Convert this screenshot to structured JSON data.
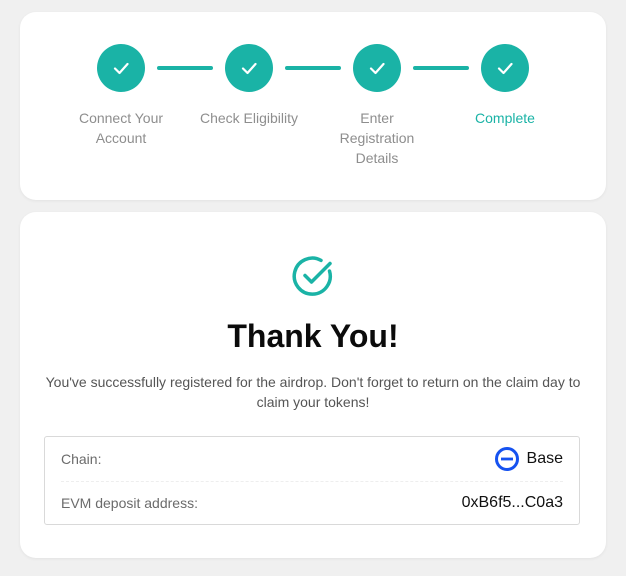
{
  "colors": {
    "accent": "#1ab3a6",
    "base_blue": "#1652f0"
  },
  "stepper": {
    "steps": [
      {
        "label": "Connect Your Account",
        "status": "done",
        "icon": "check-icon"
      },
      {
        "label": "Check Eligibility",
        "status": "done",
        "icon": "check-icon"
      },
      {
        "label": "Enter Registration Details",
        "status": "done",
        "icon": "check-icon"
      },
      {
        "label": "Complete",
        "status": "current",
        "icon": "check-icon"
      }
    ]
  },
  "confirmation": {
    "icon": "check-circle-icon",
    "title": "Thank You!",
    "message": "You've successfully registered for the airdrop. Don't forget to return on the claim day to claim your tokens!"
  },
  "details": {
    "chain_label": "Chain:",
    "chain_value": "Base",
    "chain_icon": "base-chain-icon",
    "address_label": "EVM deposit address:",
    "address_value": "0xB6f5...C0a3"
  }
}
